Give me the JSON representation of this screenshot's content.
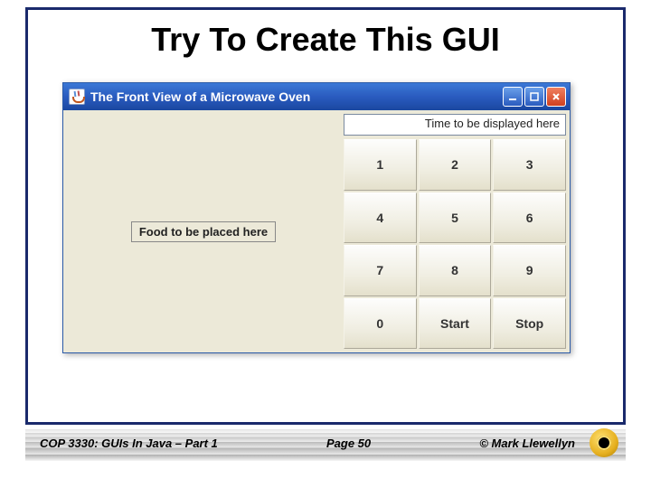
{
  "slide": {
    "title": "Try To Create This GUI"
  },
  "window": {
    "title": "The Front View of a Microwave Oven"
  },
  "foodLabel": "Food to be placed here",
  "displayText": "Time to be displayed here",
  "keypad": {
    "rows": [
      [
        "1",
        "2",
        "3"
      ],
      [
        "4",
        "5",
        "6"
      ],
      [
        "7",
        "8",
        "9"
      ],
      [
        "0",
        "Start",
        "Stop"
      ]
    ]
  },
  "footer": {
    "course": "COP 3330:  GUIs In Java – Part 1",
    "page": "Page 50",
    "copyright": "© Mark Llewellyn"
  }
}
